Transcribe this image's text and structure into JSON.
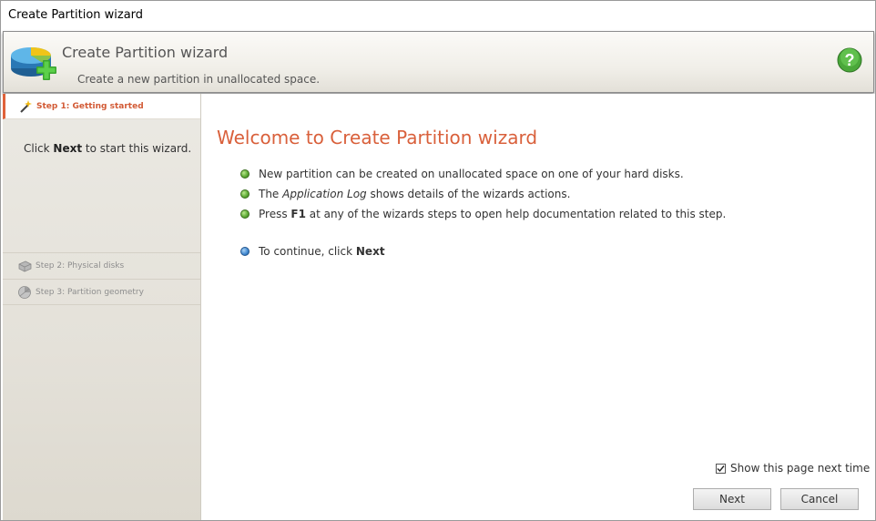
{
  "window": {
    "title": "Create Partition wizard"
  },
  "header": {
    "title": "Create Partition wizard",
    "subtitle": "Create a new partition in unallocated space.",
    "icon": "disk-add-icon",
    "help_icon": "help-icon"
  },
  "sidebar": {
    "active_step": {
      "label": "Step 1: Getting started",
      "icon": "wand-icon"
    },
    "description": {
      "prefix": "Click ",
      "bold": "Next",
      "suffix": " to start this wizard."
    },
    "steps": [
      {
        "label": "Step 2: Physical disks",
        "icon": "disk-icon"
      },
      {
        "label": "Step 3: Partition geometry",
        "icon": "partition-icon"
      }
    ]
  },
  "main": {
    "title": "Welcome to Create Partition wizard",
    "bullets": [
      {
        "text": "New partition can be created on unallocated space on one of your hard disks."
      },
      {
        "prefix": "The ",
        "italic": "Application Log",
        "suffix": " shows details of the wizards actions."
      },
      {
        "prefix": "Press ",
        "bold": "F1",
        "suffix": " at any of the wizards steps to open help documentation related to this step."
      }
    ],
    "continue": {
      "prefix": "To continue, click ",
      "bold": "Next"
    }
  },
  "footer": {
    "show_page_label": "Show this page next time",
    "show_page_checked": true,
    "next_label": "Next",
    "cancel_label": "Cancel"
  },
  "colors": {
    "accent": "#d9603b",
    "bullet_green": "#5aa832",
    "bullet_blue": "#3e86cf"
  }
}
